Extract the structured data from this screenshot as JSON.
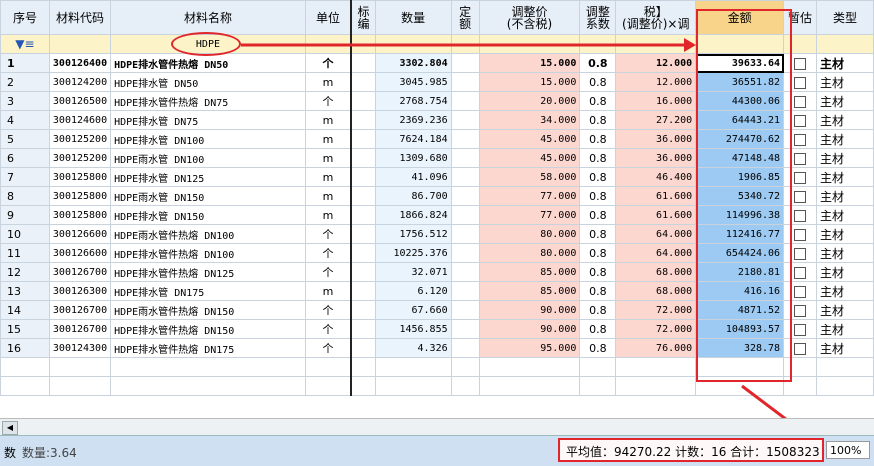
{
  "columns": [
    "序号",
    "材料代码",
    "材料名称",
    "单位",
    "标编",
    "数量",
    "定额",
    "调整价\n(不含税)",
    "调整\n系数",
    "税】\n(调整价)×调",
    "金额",
    "暂估",
    "类型"
  ],
  "filter": {
    "icon": "filter-icon",
    "name_value": "HDPE"
  },
  "rows": [
    {
      "n": "1",
      "code": "300126400",
      "name": "HDPE排水管件热熔 DN50",
      "unit": "个",
      "qty": "3302.804",
      "price": "15.000",
      "coef": "0.8",
      "price2": "12.000",
      "amt": "39633.64",
      "type": "主材"
    },
    {
      "n": "2",
      "code": "300124200",
      "name": "HDPE排水管 DN50",
      "unit": "m",
      "qty": "3045.985",
      "price": "15.000",
      "coef": "0.8",
      "price2": "12.000",
      "amt": "36551.82",
      "type": "主材"
    },
    {
      "n": "3",
      "code": "300126500",
      "name": "HDPE排水管件热熔 DN75",
      "unit": "个",
      "qty": "2768.754",
      "price": "20.000",
      "coef": "0.8",
      "price2": "16.000",
      "amt": "44300.06",
      "type": "主材"
    },
    {
      "n": "4",
      "code": "300124600",
      "name": "HDPE排水管 DN75",
      "unit": "m",
      "qty": "2369.236",
      "price": "34.000",
      "coef": "0.8",
      "price2": "27.200",
      "amt": "64443.21",
      "type": "主材"
    },
    {
      "n": "5",
      "code": "300125200",
      "name": "HDPE排水管 DN100",
      "unit": "m",
      "qty": "7624.184",
      "price": "45.000",
      "coef": "0.8",
      "price2": "36.000",
      "amt": "274470.62",
      "type": "主材"
    },
    {
      "n": "6",
      "code": "300125200",
      "name": "HDPE雨水管 DN100",
      "unit": "m",
      "qty": "1309.680",
      "price": "45.000",
      "coef": "0.8",
      "price2": "36.000",
      "amt": "47148.48",
      "type": "主材"
    },
    {
      "n": "7",
      "code": "300125800",
      "name": "HDPE排水管 DN125",
      "unit": "m",
      "qty": "41.096",
      "price": "58.000",
      "coef": "0.8",
      "price2": "46.400",
      "amt": "1906.85",
      "type": "主材"
    },
    {
      "n": "8",
      "code": "300125800",
      "name": "HDPE雨水管 DN150",
      "unit": "m",
      "qty": "86.700",
      "price": "77.000",
      "coef": "0.8",
      "price2": "61.600",
      "amt": "5340.72",
      "type": "主材"
    },
    {
      "n": "9",
      "code": "300125800",
      "name": "HDPE排水管 DN150",
      "unit": "m",
      "qty": "1866.824",
      "price": "77.000",
      "coef": "0.8",
      "price2": "61.600",
      "amt": "114996.38",
      "type": "主材"
    },
    {
      "n": "10",
      "code": "300126600",
      "name": "HDPE雨水管件热熔 DN100",
      "unit": "个",
      "qty": "1756.512",
      "price": "80.000",
      "coef": "0.8",
      "price2": "64.000",
      "amt": "112416.77",
      "type": "主材"
    },
    {
      "n": "11",
      "code": "300126600",
      "name": "HDPE排水管件热熔 DN100",
      "unit": "个",
      "qty": "10225.376",
      "price": "80.000",
      "coef": "0.8",
      "price2": "64.000",
      "amt": "654424.06",
      "type": "主材"
    },
    {
      "n": "12",
      "code": "300126700",
      "name": "HDPE排水管件热熔 DN125",
      "unit": "个",
      "qty": "32.071",
      "price": "85.000",
      "coef": "0.8",
      "price2": "68.000",
      "amt": "2180.81",
      "type": "主材"
    },
    {
      "n": "13",
      "code": "300126300",
      "name": "HDPE排水管 DN175",
      "unit": "m",
      "qty": "6.120",
      "price": "85.000",
      "coef": "0.8",
      "price2": "68.000",
      "amt": "416.16",
      "type": "主材"
    },
    {
      "n": "14",
      "code": "300126700",
      "name": "HDPE雨水管件热熔 DN150",
      "unit": "个",
      "qty": "67.660",
      "price": "90.000",
      "coef": "0.8",
      "price2": "72.000",
      "amt": "4871.52",
      "type": "主材"
    },
    {
      "n": "15",
      "code": "300126700",
      "name": "HDPE排水管件热熔 DN150",
      "unit": "个",
      "qty": "1456.855",
      "price": "90.000",
      "coef": "0.8",
      "price2": "72.000",
      "amt": "104893.57",
      "type": "主材"
    },
    {
      "n": "16",
      "code": "300124300",
      "name": "HDPE排水管件热熔 DN175",
      "unit": "个",
      "qty": "4.326",
      "price": "95.000",
      "coef": "0.8",
      "price2": "76.000",
      "amt": "328.78",
      "type": "主材"
    }
  ],
  "status": {
    "left_label": "数",
    "left_text": "数量:3.64",
    "summary": "平均值：94270.22  计数：16  合计：1508323",
    "zoom": "100%"
  },
  "colors": {
    "highlight": "#e0262b",
    "amount_fill": "#9ccaf2",
    "price_fill": "#fcd7d0",
    "header_amount": "#f7d48a"
  }
}
